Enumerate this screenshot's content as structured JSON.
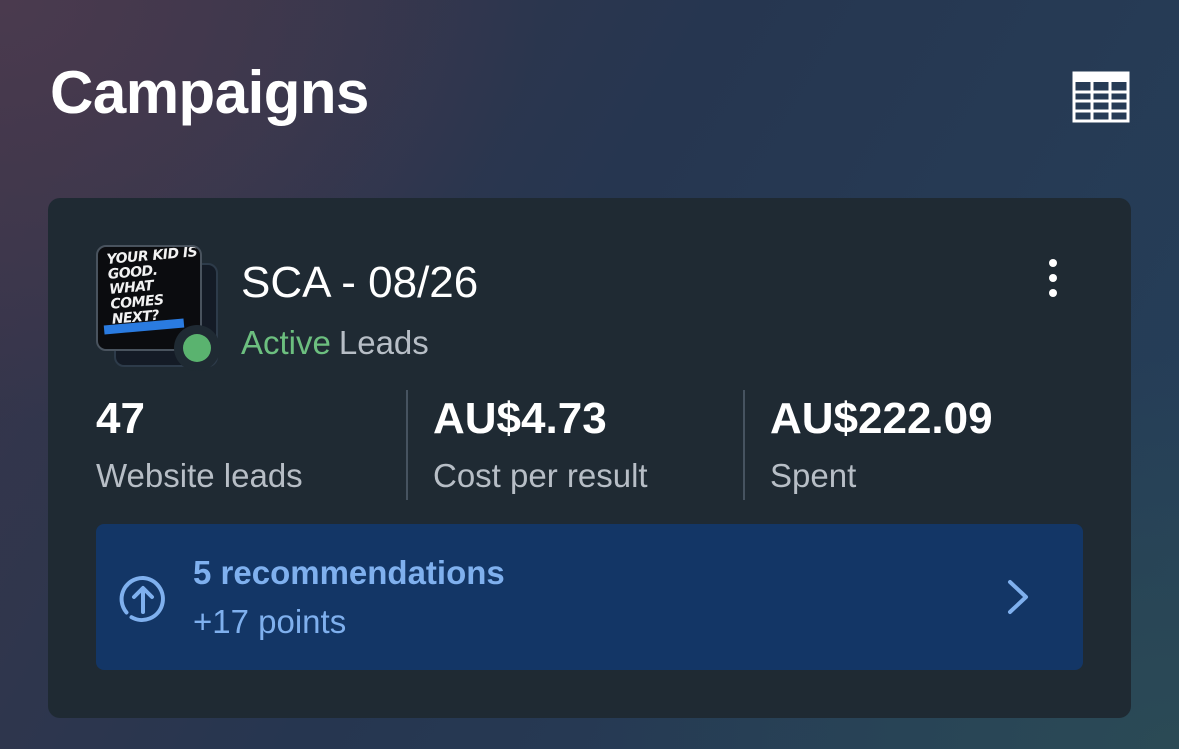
{
  "header": {
    "title": "Campaigns",
    "table_view_icon": "table-grid-icon"
  },
  "campaign": {
    "name": "SCA - 08/26",
    "status": "Active",
    "objective": "Leads",
    "status_color": "#5ab36f",
    "thumbnail": {
      "slogan": "YOUR KID IS GOOD. WHAT COMES NEXT?"
    },
    "more_icon": "vertical-ellipsis-icon",
    "metrics": [
      {
        "value": "47",
        "label": "Website leads"
      },
      {
        "value": "AU$4.73",
        "label": "Cost per result"
      },
      {
        "value": "AU$222.09",
        "label": "Spent"
      }
    ],
    "recommendations": {
      "title": "5 recommendations",
      "subtitle": "+17 points",
      "icon": "arrow-up-circle-icon",
      "chevron_icon": "chevron-right-icon",
      "accent_color": "#7fb0ee",
      "background_color": "#133666"
    }
  }
}
